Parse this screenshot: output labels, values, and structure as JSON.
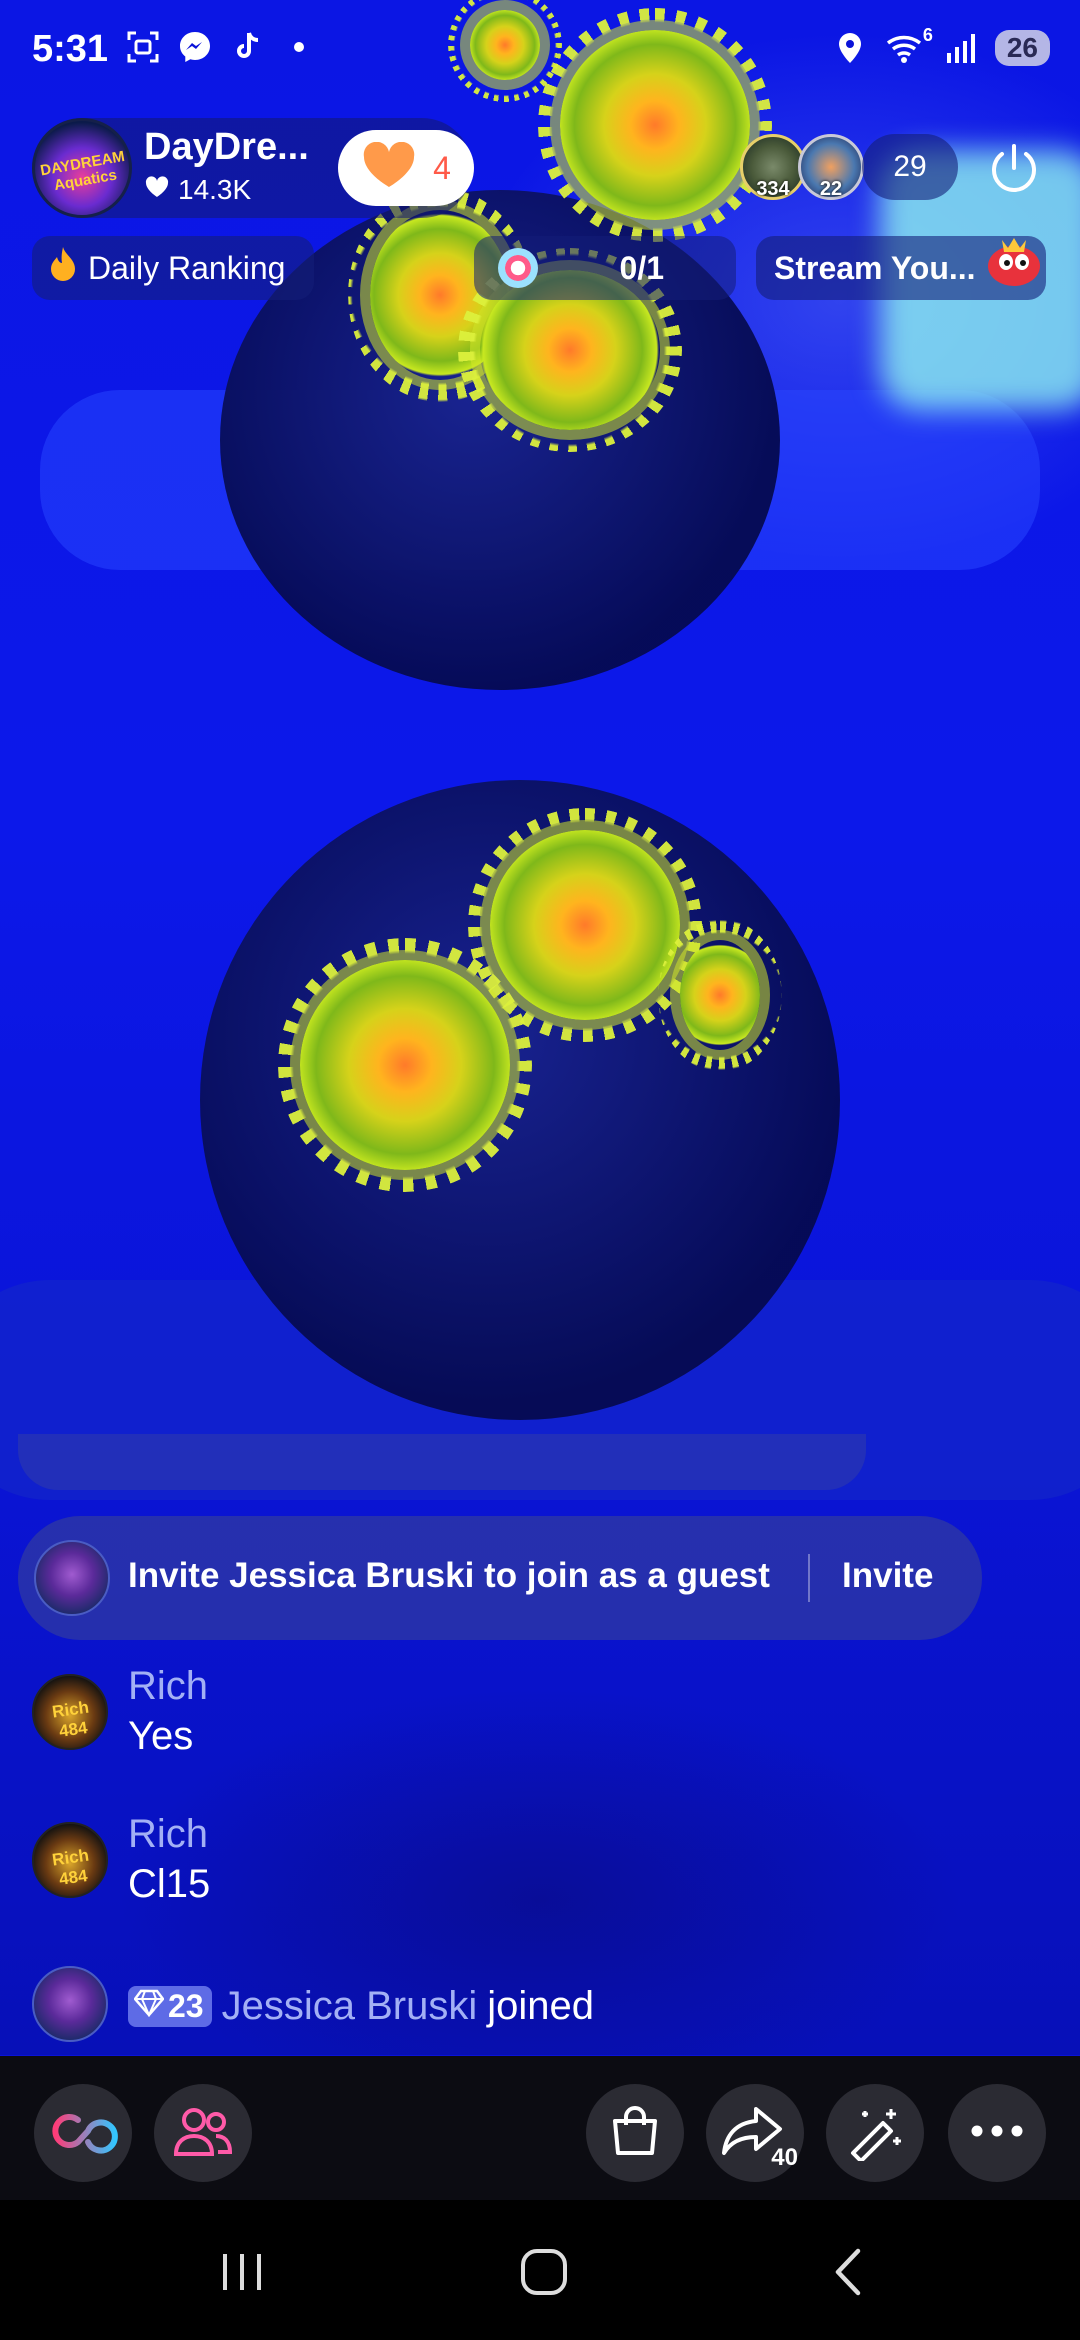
{
  "status_bar": {
    "time": "5:31",
    "battery": "26",
    "wifi_superscript": "6",
    "left_icons": [
      "screenshot-icon",
      "messenger-icon",
      "tiktok-icon",
      "dot-icon"
    ],
    "right_icons": [
      "location-icon",
      "wifi-icon",
      "signal-icon",
      "battery-icon"
    ]
  },
  "host": {
    "name": "DayDre...",
    "likes": "14.3K",
    "avatar_text": "DAYDREAM Aquatics",
    "follow_count": "4"
  },
  "viewers": {
    "avatars": [
      {
        "badge": "334"
      },
      {
        "badge": "22"
      }
    ],
    "count": "29"
  },
  "ranking": {
    "label": "Daily Ranking"
  },
  "goal": {
    "progress": "0/1"
  },
  "stream": {
    "label": "Stream You..."
  },
  "chat": {
    "invite": {
      "text": "Invite Jessica Bruski to join as a guest",
      "button": "Invite"
    },
    "messages": [
      {
        "user": "Rich",
        "text": "Yes",
        "avatar_text": "Rich 484"
      },
      {
        "user": "Rich",
        "text": "Cl15",
        "avatar_text": "Rich 484"
      }
    ],
    "join": {
      "level": "23",
      "user": "Jessica Bruski",
      "action": "joined"
    }
  },
  "bottom_bar": {
    "share_count": "40",
    "buttons": [
      "link-icon",
      "guests-icon",
      "shop-icon",
      "share-icon",
      "effects-icon",
      "more-icon"
    ]
  },
  "colors": {
    "background": "#0a12d8",
    "accent_coral": "#ff5a48",
    "username": "#a3b0f5",
    "level_badge": "#5e6be6"
  }
}
